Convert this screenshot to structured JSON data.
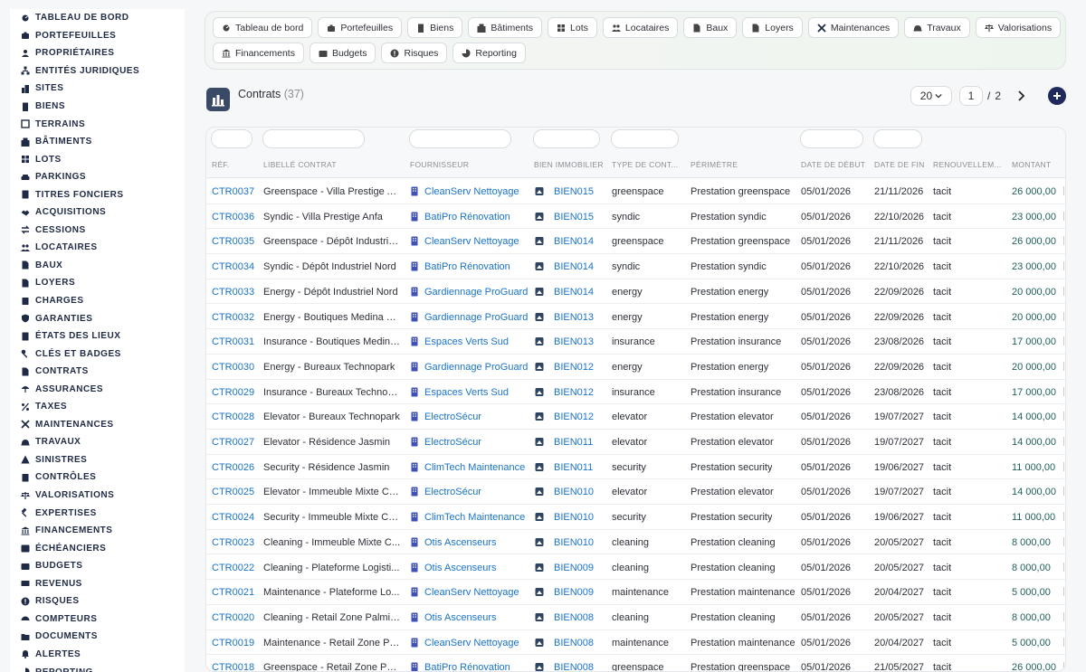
{
  "sidebar": {
    "items": [
      {
        "label": "TABLEAU DE BORD",
        "icon": "dashboard-icon"
      },
      {
        "label": "PORTEFEUILLES",
        "icon": "briefcase-icon"
      },
      {
        "label": "PROPRIÉTAIRES",
        "icon": "user-icon"
      },
      {
        "label": "ENTITÉS JURIDIQUES",
        "icon": "hierarchy-icon"
      },
      {
        "label": "SITES",
        "icon": "city-icon"
      },
      {
        "label": "BIENS",
        "icon": "building-icon"
      },
      {
        "label": "TERRAINS",
        "icon": "area-icon"
      },
      {
        "label": "BÂTIMENTS",
        "icon": "apartment-icon"
      },
      {
        "label": "LOTS",
        "icon": "grid-icon"
      },
      {
        "label": "PARKINGS",
        "icon": "car-icon"
      },
      {
        "label": "TITRES FONCIERS",
        "icon": "document-signed-icon"
      },
      {
        "label": "ACQUISITIONS",
        "icon": "handshake-icon"
      },
      {
        "label": "CESSIONS",
        "icon": "transfer-icon"
      },
      {
        "label": "LOCATAIRES",
        "icon": "users-icon"
      },
      {
        "label": "BAUX",
        "icon": "file-icon"
      },
      {
        "label": "LOYERS",
        "icon": "invoice-icon"
      },
      {
        "label": "CHARGES",
        "icon": "receipt-icon"
      },
      {
        "label": "GARANTIES",
        "icon": "shield-icon"
      },
      {
        "label": "ÉTATS DES LIEUX",
        "icon": "checklist-icon"
      },
      {
        "label": "CLÉS ET BADGES",
        "icon": "key-icon"
      },
      {
        "label": "CONTRATS",
        "icon": "contract-icon"
      },
      {
        "label": "ASSURANCES",
        "icon": "umbrella-icon"
      },
      {
        "label": "TAXES",
        "icon": "percent-icon"
      },
      {
        "label": "MAINTENANCES",
        "icon": "tools-icon"
      },
      {
        "label": "TRAVAUX",
        "icon": "hard-hat-icon"
      },
      {
        "label": "SINISTRES",
        "icon": "warning-icon"
      },
      {
        "label": "CONTRÔLES",
        "icon": "clipboard-check-icon"
      },
      {
        "label": "VALORISATIONS",
        "icon": "scale-icon"
      },
      {
        "label": "EXPERTISES",
        "icon": "gavel-icon"
      },
      {
        "label": "FINANCEMENTS",
        "icon": "bank-icon"
      },
      {
        "label": "ÉCHÉANCIERS",
        "icon": "calendar-icon"
      },
      {
        "label": "BUDGETS",
        "icon": "wallet-icon"
      },
      {
        "label": "REVENUS",
        "icon": "money-icon"
      },
      {
        "label": "RISQUES",
        "icon": "alert-circle-icon"
      },
      {
        "label": "COMPTEURS",
        "icon": "gauge-icon"
      },
      {
        "label": "DOCUMENTS",
        "icon": "folder-icon"
      },
      {
        "label": "ALERTES",
        "icon": "bell-icon"
      },
      {
        "label": "REPORTING",
        "icon": "chart-pie-icon"
      }
    ]
  },
  "modules": {
    "row1": [
      {
        "label": "Tableau de bord",
        "icon": "dashboard-icon"
      },
      {
        "label": "Portefeuilles",
        "icon": "briefcase-icon"
      },
      {
        "label": "Biens",
        "icon": "building-icon"
      },
      {
        "label": "Bâtiments",
        "icon": "apartment-icon"
      },
      {
        "label": "Lots",
        "icon": "grid-icon"
      },
      {
        "label": "Locataires",
        "icon": "users-icon"
      },
      {
        "label": "Baux",
        "icon": "file-icon"
      },
      {
        "label": "Loyers",
        "icon": "invoice-icon"
      },
      {
        "label": "Maintenances",
        "icon": "tools-icon"
      },
      {
        "label": "Travaux",
        "icon": "hard-hat-icon"
      },
      {
        "label": "Valorisations",
        "icon": "scale-icon"
      }
    ],
    "row2": [
      {
        "label": "Financements",
        "icon": "bank-icon"
      },
      {
        "label": "Budgets",
        "icon": "wallet-icon"
      },
      {
        "label": "Risques",
        "icon": "alert-circle-icon"
      },
      {
        "label": "Reporting",
        "icon": "chart-pie-icon"
      }
    ]
  },
  "header": {
    "title": "Contrats",
    "count": "(37)",
    "page_size": "20",
    "page_current": "1",
    "page_sep": "/",
    "page_total": "2"
  },
  "table": {
    "columns": [
      "RÉF.",
      "LIBELLÉ CONTRAT",
      "FOURNISSEUR",
      "BIEN IMMOBILIER",
      "TYPE DE CONT...",
      "PÉRIMÈTRE",
      "DATE DE DÉBUT",
      "DATE DE FIN",
      "RENOUVELLEM...",
      "MONTANT"
    ],
    "rows": [
      {
        "ref": "CTR0037",
        "label": "Greenspace - Villa Prestige A...",
        "supplier": "CleanServ Nettoyage",
        "bien": "BIEN015",
        "type": "greenspace",
        "scope": "Prestation greenspace",
        "start": "05/01/2026",
        "end": "21/11/2026",
        "renew": "tacit",
        "amount": "26 000,00"
      },
      {
        "ref": "CTR0036",
        "label": "Syndic - Villa Prestige Anfa",
        "supplier": "BatiPro Rénovation",
        "bien": "BIEN015",
        "type": "syndic",
        "scope": "Prestation syndic",
        "start": "05/01/2026",
        "end": "22/10/2026",
        "renew": "tacit",
        "amount": "23 000,00"
      },
      {
        "ref": "CTR0035",
        "label": "Greenspace - Dépôt Industrie...",
        "supplier": "CleanServ Nettoyage",
        "bien": "BIEN014",
        "type": "greenspace",
        "scope": "Prestation greenspace",
        "start": "05/01/2026",
        "end": "21/11/2026",
        "renew": "tacit",
        "amount": "26 000,00"
      },
      {
        "ref": "CTR0034",
        "label": "Syndic - Dépôt Industriel Nord",
        "supplier": "BatiPro Rénovation",
        "bien": "BIEN014",
        "type": "syndic",
        "scope": "Prestation syndic",
        "start": "05/01/2026",
        "end": "22/10/2026",
        "renew": "tacit",
        "amount": "23 000,00"
      },
      {
        "ref": "CTR0033",
        "label": "Energy - Dépôt Industriel Nord",
        "supplier": "Gardiennage ProGuard",
        "bien": "BIEN014",
        "type": "energy",
        "scope": "Prestation energy",
        "start": "05/01/2026",
        "end": "22/09/2026",
        "renew": "tacit",
        "amount": "20 000,00"
      },
      {
        "ref": "CTR0032",
        "label": "Energy - Boutiques Medina Mall",
        "supplier": "Gardiennage ProGuard",
        "bien": "BIEN013",
        "type": "energy",
        "scope": "Prestation energy",
        "start": "05/01/2026",
        "end": "22/09/2026",
        "renew": "tacit",
        "amount": "20 000,00"
      },
      {
        "ref": "CTR0031",
        "label": "Insurance - Boutiques Medina...",
        "supplier": "Espaces Verts Sud",
        "bien": "BIEN013",
        "type": "insurance",
        "scope": "Prestation insurance",
        "start": "05/01/2026",
        "end": "23/08/2026",
        "renew": "tacit",
        "amount": "17 000,00"
      },
      {
        "ref": "CTR0030",
        "label": "Energy - Bureaux Technopark",
        "supplier": "Gardiennage ProGuard",
        "bien": "BIEN012",
        "type": "energy",
        "scope": "Prestation energy",
        "start": "05/01/2026",
        "end": "22/09/2026",
        "renew": "tacit",
        "amount": "20 000,00"
      },
      {
        "ref": "CTR0029",
        "label": "Insurance - Bureaux Technop...",
        "supplier": "Espaces Verts Sud",
        "bien": "BIEN012",
        "type": "insurance",
        "scope": "Prestation insurance",
        "start": "05/01/2026",
        "end": "23/08/2026",
        "renew": "tacit",
        "amount": "17 000,00"
      },
      {
        "ref": "CTR0028",
        "label": "Elevator - Bureaux Technopark",
        "supplier": "ElectroSécur",
        "bien": "BIEN012",
        "type": "elevator",
        "scope": "Prestation elevator",
        "start": "05/01/2026",
        "end": "19/07/2027",
        "renew": "tacit",
        "amount": "14 000,00"
      },
      {
        "ref": "CTR0027",
        "label": "Elevator - Résidence Jasmin",
        "supplier": "ElectroSécur",
        "bien": "BIEN011",
        "type": "elevator",
        "scope": "Prestation elevator",
        "start": "05/01/2026",
        "end": "19/07/2027",
        "renew": "tacit",
        "amount": "14 000,00"
      },
      {
        "ref": "CTR0026",
        "label": "Security - Résidence Jasmin",
        "supplier": "ClimTech Maintenance",
        "bien": "BIEN011",
        "type": "security",
        "scope": "Prestation security",
        "start": "05/01/2026",
        "end": "19/06/2027",
        "renew": "tacit",
        "amount": "11 000,00"
      },
      {
        "ref": "CTR0025",
        "label": "Elevator - Immeuble Mixte Co...",
        "supplier": "ElectroSécur",
        "bien": "BIEN010",
        "type": "elevator",
        "scope": "Prestation elevator",
        "start": "05/01/2026",
        "end": "19/07/2027",
        "renew": "tacit",
        "amount": "14 000,00"
      },
      {
        "ref": "CTR0024",
        "label": "Security - Immeuble Mixte Co...",
        "supplier": "ClimTech Maintenance",
        "bien": "BIEN010",
        "type": "security",
        "scope": "Prestation security",
        "start": "05/01/2026",
        "end": "19/06/2027",
        "renew": "tacit",
        "amount": "11 000,00"
      },
      {
        "ref": "CTR0023",
        "label": "Cleaning - Immeuble Mixte C...",
        "supplier": "Otis Ascenseurs",
        "bien": "BIEN010",
        "type": "cleaning",
        "scope": "Prestation cleaning",
        "start": "05/01/2026",
        "end": "20/05/2027",
        "renew": "tacit",
        "amount": "8 000,00"
      },
      {
        "ref": "CTR0022",
        "label": "Cleaning - Plateforme Logisti...",
        "supplier": "Otis Ascenseurs",
        "bien": "BIEN009",
        "type": "cleaning",
        "scope": "Prestation cleaning",
        "start": "05/01/2026",
        "end": "20/05/2027",
        "renew": "tacit",
        "amount": "8 000,00"
      },
      {
        "ref": "CTR0021",
        "label": "Maintenance - Plateforme Lo...",
        "supplier": "CleanServ Nettoyage",
        "bien": "BIEN009",
        "type": "maintenance",
        "scope": "Prestation maintenance",
        "start": "05/01/2026",
        "end": "20/04/2027",
        "renew": "tacit",
        "amount": "5 000,00"
      },
      {
        "ref": "CTR0020",
        "label": "Cleaning - Retail Zone Palmiers",
        "supplier": "Otis Ascenseurs",
        "bien": "BIEN008",
        "type": "cleaning",
        "scope": "Prestation cleaning",
        "start": "05/01/2026",
        "end": "20/05/2027",
        "renew": "tacit",
        "amount": "8 000,00"
      },
      {
        "ref": "CTR0019",
        "label": "Maintenance - Retail Zone Pa...",
        "supplier": "CleanServ Nettoyage",
        "bien": "BIEN008",
        "type": "maintenance",
        "scope": "Prestation maintenance",
        "start": "05/01/2026",
        "end": "20/04/2027",
        "renew": "tacit",
        "amount": "5 000,00"
      },
      {
        "ref": "CTR0018",
        "label": "Greenspace - Retail Zone Pal...",
        "supplier": "BatiPro Rénovation",
        "bien": "BIEN008",
        "type": "greenspace",
        "scope": "Prestation greenspace",
        "start": "05/01/2026",
        "end": "21/05/2027",
        "renew": "tacit",
        "amount": "26 000,00"
      }
    ]
  },
  "colors": {
    "link": "#1a73c7",
    "amount": "#1f5f5b",
    "navy": "#1f2a44",
    "add_button": "#1f2a5c"
  }
}
